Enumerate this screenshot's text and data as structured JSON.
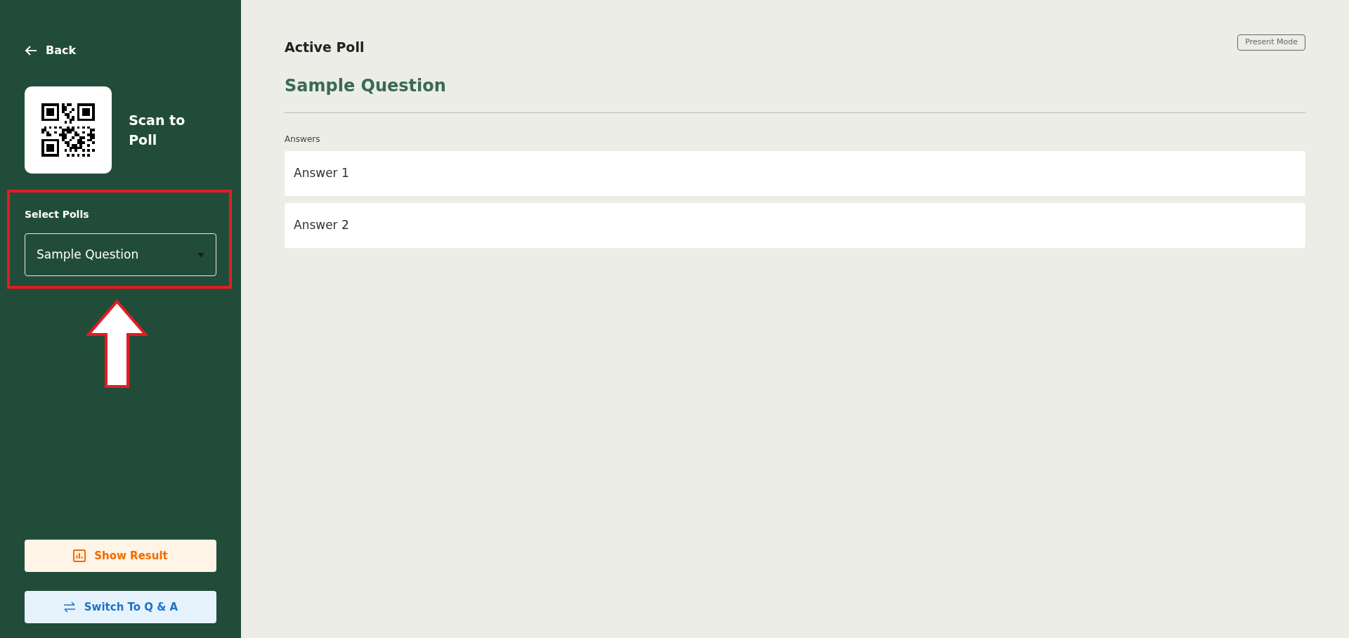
{
  "sidebar": {
    "back_link": "Back",
    "qr_caption": "Scan to Poll",
    "poll_select": {
      "label": "Select Polls",
      "value": "Sample Question"
    },
    "buttons": [
      {
        "label": "Show Result",
        "kind": "result"
      },
      {
        "label": "Switch To Q & A",
        "kind": "switch"
      }
    ]
  },
  "main": {
    "title": "Active Poll",
    "present_button": "Present Mode",
    "question": "Sample Question",
    "answers_label": "Answers",
    "answers": [
      "Answer 1",
      "Answer 2"
    ]
  }
}
